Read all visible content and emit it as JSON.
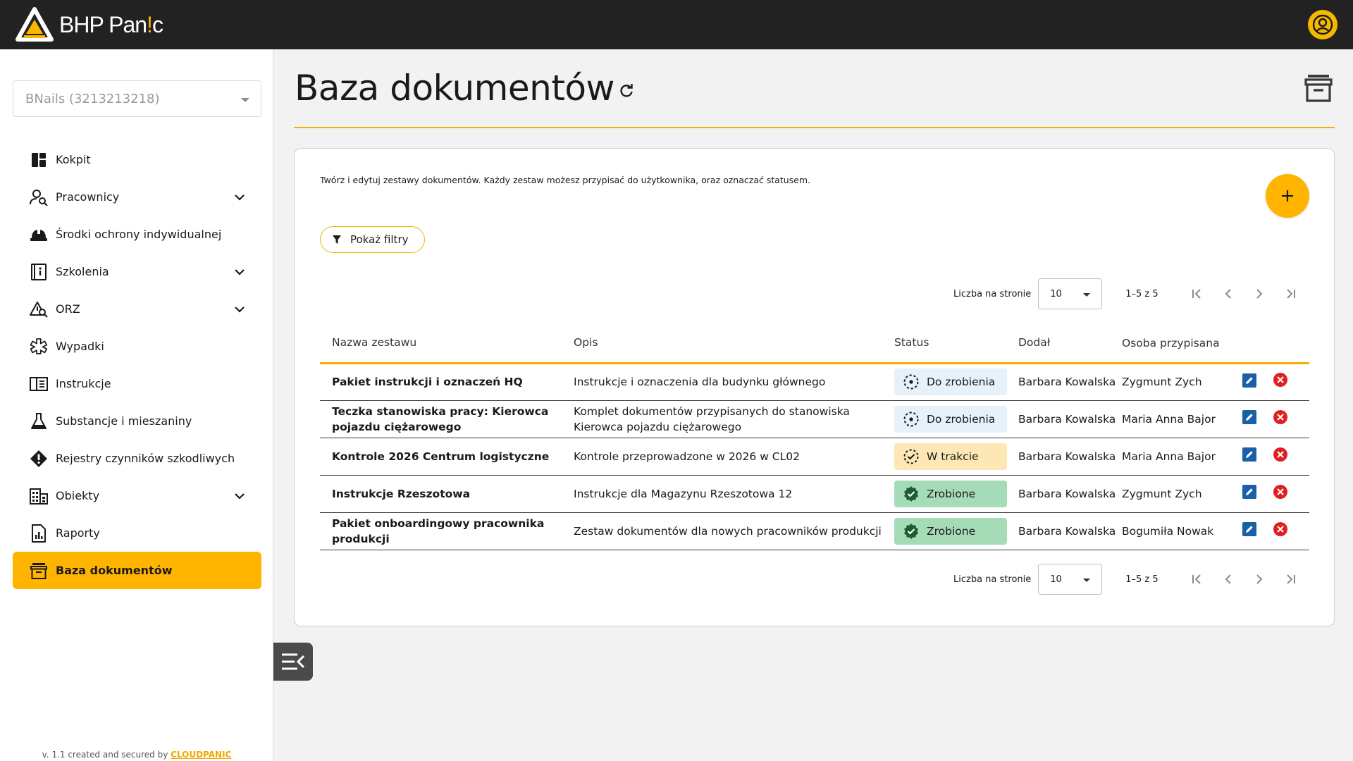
{
  "app": {
    "name": "BHP Panic",
    "name_main": "BHP Pan",
    "name_accent": "!",
    "name_end": "c"
  },
  "colors": {
    "accent": "#ffb500",
    "topbar": "#222222",
    "todo": "#e6f1fa",
    "inprogress": "#fde8b5",
    "done": "#a6dbb7",
    "edit": "#1a5fa8",
    "delete": "#e02020"
  },
  "sidebar": {
    "company": "BNails (3213213218)",
    "items": [
      {
        "label": "Kokpit",
        "icon": "dashboard-icon",
        "has_children": false
      },
      {
        "label": "Pracownicy",
        "icon": "user-search-icon",
        "has_children": true
      },
      {
        "label": "Środki ochrony indywidualnej",
        "icon": "hard-hat-icon",
        "has_children": false
      },
      {
        "label": "Szkolenia",
        "icon": "training-book-icon",
        "has_children": true
      },
      {
        "label": "ORZ",
        "icon": "warning-search-icon",
        "has_children": true
      },
      {
        "label": "Wypadki",
        "icon": "medical-star-icon",
        "has_children": false
      },
      {
        "label": "Instrukcje",
        "icon": "instructions-book-icon",
        "has_children": false
      },
      {
        "label": "Substancje i mieszaniny",
        "icon": "flask-icon",
        "has_children": false
      },
      {
        "label": "Rejestry czynników szkodliwych",
        "icon": "hazard-diamond-icon",
        "has_children": false
      },
      {
        "label": "Obiekty",
        "icon": "building-icon",
        "has_children": true
      },
      {
        "label": "Raporty",
        "icon": "report-chart-icon",
        "has_children": false
      },
      {
        "label": "Baza dokumentów",
        "icon": "archive-box-icon",
        "has_children": false,
        "active": true
      }
    ],
    "footer_text": "v. 1.1 created and secured by ",
    "footer_brand": "CLOUDPANIC"
  },
  "page": {
    "title": "Baza dokumentów",
    "description": "Twórz i edytuj zestawy dokumentów. Każdy zestaw możesz przypisać do użytkownika, oraz oznaczać statusem.",
    "filter_label": "Pokaż filtry"
  },
  "pagination": {
    "per_page_label": "Liczba na stronie",
    "per_page": "10",
    "range": "1–5 z 5"
  },
  "table": {
    "columns": [
      "Nazwa zestawu",
      "Opis",
      "Status",
      "Dodał",
      "Osoba przypisana"
    ],
    "rows": [
      {
        "name": "Pakiet instrukcji i oznaczeń HQ",
        "desc": "Instrukcje i oznaczenia dla budynku głównego",
        "status": "Do zrobienia",
        "status_type": "todo",
        "added_by": "Barbara Kowalska",
        "assigned": "Zygmunt Zych"
      },
      {
        "name": "Teczka stanowiska pracy: Kierowca pojazdu ciężarowego",
        "desc": "Komplet dokumentów przypisanych do stanowiska Kierowca pojazdu ciężarowego",
        "status": "Do zrobienia",
        "status_type": "todo",
        "added_by": "Barbara Kowalska",
        "assigned": "Maria Anna Bajor"
      },
      {
        "name": "Kontrole 2026 Centrum logistyczne",
        "desc": "Kontrole przeprowadzone w 2026 w CL02",
        "status": "W trakcie",
        "status_type": "inprogress",
        "added_by": "Barbara Kowalska",
        "assigned": "Maria Anna Bajor"
      },
      {
        "name": "Instrukcje Rzeszotowa",
        "desc": "Instrukcje dla Magazynu Rzeszotowa 12",
        "status": "Zrobione",
        "status_type": "done",
        "added_by": "Barbara Kowalska",
        "assigned": "Zygmunt Zych"
      },
      {
        "name": "Pakiet onboardingowy pracownika produkcji",
        "desc": "Zestaw dokumentów dla nowych pracowników produkcji",
        "status": "Zrobione",
        "status_type": "done",
        "added_by": "Barbara Kowalska",
        "assigned": "Bogumiła Nowak"
      }
    ]
  }
}
